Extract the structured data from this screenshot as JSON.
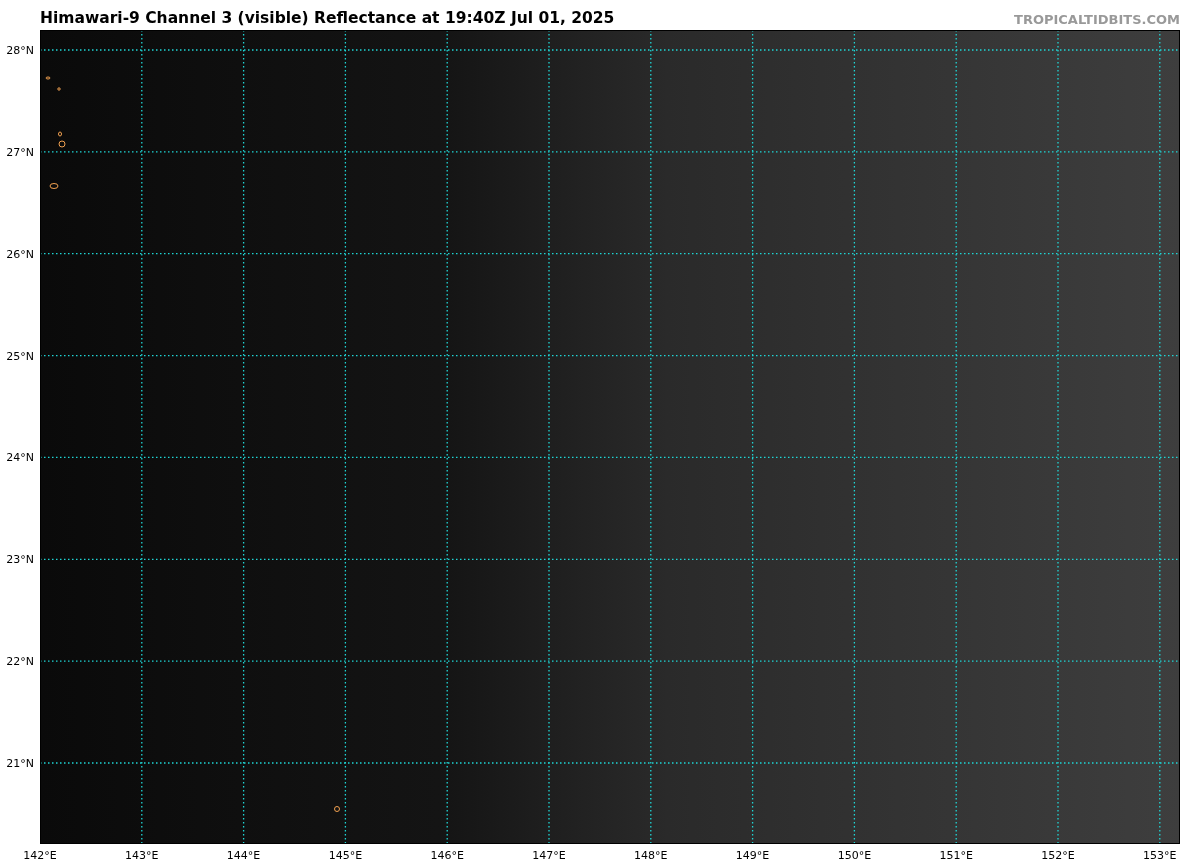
{
  "title": "Himawari-9 Channel 3 (visible) Reflectance at 19:40Z Jul 01, 2025",
  "credit": "TROPICALTIDBITS.COM",
  "map": {
    "lat_labels": [
      "28°N",
      "27°N",
      "26°N",
      "25°N",
      "24°N",
      "23°N",
      "22°N",
      "21°N"
    ],
    "lon_labels": [
      "142°E",
      "143°E",
      "144°E",
      "145°E",
      "146°E",
      "147°E",
      "148°E",
      "149°E",
      "150°E",
      "151°E",
      "152°E",
      "153°E"
    ]
  }
}
